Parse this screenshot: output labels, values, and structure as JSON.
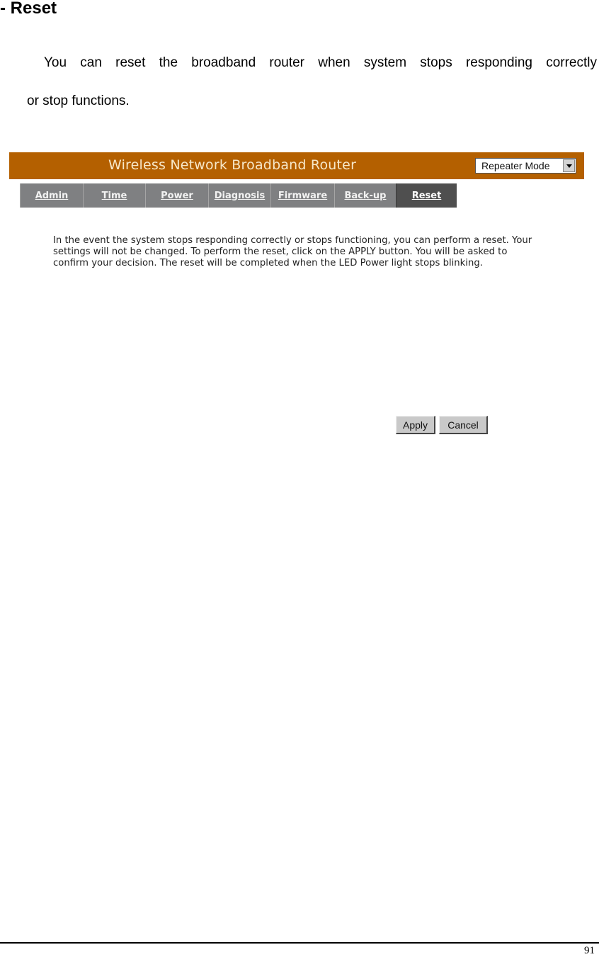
{
  "document": {
    "heading": "- Reset",
    "paragraph_line1": "You can reset the broadband router when system stops responding correctly",
    "paragraph_line2": "or stop functions.",
    "page_number": "91"
  },
  "router_ui": {
    "banner_title": "Wireless Network Broadband Router",
    "mode_select": {
      "selected": "Repeater Mode",
      "icon": "chevron-down-icon"
    },
    "tabs": [
      {
        "label": "Admin",
        "active": false
      },
      {
        "label": "Time",
        "active": false
      },
      {
        "label": "Power",
        "active": false
      },
      {
        "label": "Diagnosis",
        "active": false
      },
      {
        "label": "Firmware",
        "active": false
      },
      {
        "label": "Back-up",
        "active": false
      },
      {
        "label": "Reset",
        "active": true
      }
    ],
    "description": "In the event the system stops responding correctly or stops functioning, you can perform a reset. Your settings will not be changed. To perform the reset, click on the APPLY button. You will be asked to confirm your decision. The reset will be completed when the LED Power light stops blinking.",
    "buttons": {
      "apply": "Apply",
      "cancel": "Cancel"
    },
    "colors": {
      "banner": "#b46000",
      "banner_text": "#f7e8c9",
      "tab_bg": "#7f8082",
      "tab_active_bg": "#4f4f4f"
    }
  }
}
